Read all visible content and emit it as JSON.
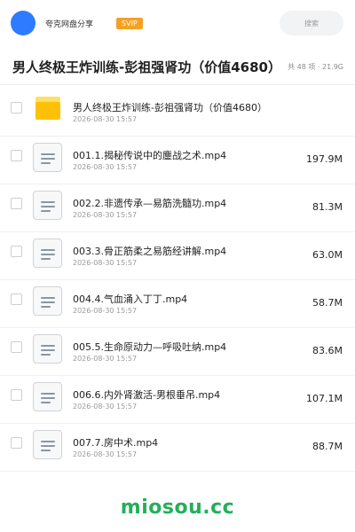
{
  "header": {
    "site_name": "夸克网盘分享",
    "vip_label": "SVIP",
    "search_placeholder": "搜索"
  },
  "folder": {
    "title": "男人终极王炸训练-彭祖强肾功（价值4680）",
    "meta": "共 48 项 · 21.9G"
  },
  "items": [
    {
      "type": "folder",
      "name": "男人终极王炸训练-彭祖强肾功（价值4680）",
      "date": "2026-08-30 15:57",
      "size": ""
    },
    {
      "type": "file",
      "name": "001.1.揭秘传说中的鏖战之术.mp4",
      "date": "2026-08-30 15:57",
      "size": "197.9M"
    },
    {
      "type": "file",
      "name": "002.2.非遗传承—易筋洗髓功.mp4",
      "date": "2026-08-30 15:57",
      "size": "81.3M"
    },
    {
      "type": "file",
      "name": "003.3.骨正筋柔之易筋经讲解.mp4",
      "date": "2026-08-30 15:57",
      "size": "63.0M"
    },
    {
      "type": "file",
      "name": "004.4.气血涌入丁丁.mp4",
      "date": "2026-08-30 15:57",
      "size": "58.7M"
    },
    {
      "type": "file",
      "name": "005.5.生命原动力—呼吸吐纳.mp4",
      "date": "2026-08-30 15:57",
      "size": "83.6M"
    },
    {
      "type": "file",
      "name": "006.6.内外肾激活-男根垂吊.mp4",
      "date": "2026-08-30 15:57",
      "size": "107.1M"
    },
    {
      "type": "file",
      "name": "007.7.房中术.mp4",
      "date": "2026-08-30 15:57",
      "size": "88.7M"
    }
  ],
  "footer": {
    "watermark": "miosou.cc"
  },
  "colors": {
    "avatar": "#2f7bff",
    "vip_badge": "#f6a024",
    "folder_icon": "#ffc107",
    "watermark": "#22b05a"
  }
}
